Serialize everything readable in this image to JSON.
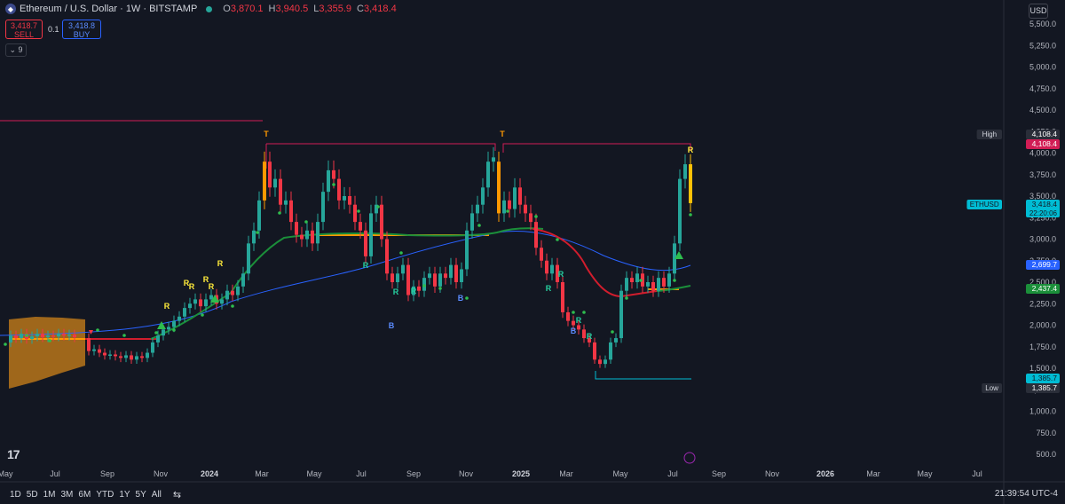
{
  "header": {
    "coin_icon": "ethereum-icon",
    "title": "Ethereum / U.S. Dollar · 1W · BITSTAMP",
    "status_color": "#26a69a",
    "ohlc": {
      "o_label": "O",
      "o": "3,870.1",
      "h_label": "H",
      "h": "3,940.5",
      "l_label": "L",
      "l": "3,355.9",
      "c_label": "C",
      "c": "3,418.4"
    }
  },
  "trade": {
    "sell_price": "3,418.7",
    "sell_label": "SELL",
    "spread": "0.1",
    "buy_price": "3,418.8",
    "buy_label": "BUY"
  },
  "indicators_toggle": "9",
  "currency": "USD",
  "price_axis": {
    "labels": [
      "5,500.0",
      "5,250.0",
      "5,000.0",
      "4,750.0",
      "4,500.0",
      "4,250.0",
      "4,000.0",
      "3,750.0",
      "3,500.0",
      "3,250.0",
      "3,000.0",
      "2,750.0",
      "2,500.0",
      "2,250.0",
      "2,000.0",
      "1,750.0",
      "1,500.0",
      "1,250.0",
      "1,000.0",
      "750.0",
      "500.0"
    ],
    "values": [
      5500,
      5250,
      5000,
      4750,
      4500,
      4250,
      4000,
      3750,
      3500,
      3250,
      3000,
      2750,
      2500,
      2250,
      2000,
      1750,
      1500,
      1250,
      1000,
      750,
      500
    ]
  },
  "price_badges": [
    {
      "label": "High",
      "value": "4,108.4",
      "color": "#2a2e39"
    },
    {
      "label": "",
      "value": "4,108.4",
      "color": "#d11d55"
    },
    {
      "label": "ETHUSD",
      "value": "3,418.4",
      "sub": "22:20:06",
      "color": "#00bcd4"
    },
    {
      "label": "",
      "value": "2,699.7",
      "color": "#2962ff"
    },
    {
      "label": "",
      "value": "2,437.4",
      "color": "#1b8f3a"
    },
    {
      "label": "",
      "value": "1,385.7",
      "color": "#00bcd4"
    },
    {
      "label": "Low",
      "value": "1,385.7",
      "color": "#2a2e39"
    }
  ],
  "time_axis": [
    "May",
    "Jul",
    "Sep",
    "Nov",
    "2024",
    "Mar",
    "May",
    "Jul",
    "Sep",
    "Nov",
    "2025",
    "Mar",
    "May",
    "Jul",
    "Sep",
    "Nov",
    "2026",
    "Mar",
    "May",
    "Jul"
  ],
  "chart_markers": {
    "top": "T",
    "reversal": "R",
    "bottom": "B"
  },
  "bottom_bar": {
    "timeframes": [
      "1D",
      "5D",
      "1M",
      "3M",
      "6M",
      "YTD",
      "1Y",
      "5Y",
      "All"
    ],
    "calendar_icon": "calendar-range-icon",
    "clock": "21:39:54 UTC-4"
  },
  "logo": "TradingView",
  "chart_data": {
    "type": "candlestick",
    "symbol": "ETHUSD",
    "interval": "1W",
    "ylim": [
      500,
      5500
    ],
    "x": [
      "2023-05",
      "2023-07",
      "2023-09",
      "2023-11",
      "2024-01",
      "2024-03",
      "2024-05",
      "2024-07",
      "2024-09",
      "2024-11",
      "2025-01",
      "2025-03",
      "2025-05",
      "2025-07"
    ],
    "close_approx": [
      1850,
      1880,
      1620,
      1950,
      2300,
      3600,
      3000,
      3200,
      2500,
      3300,
      3350,
      2100,
      1600,
      3418.4
    ],
    "last": {
      "open": 3870.1,
      "high": 3940.5,
      "low": 3355.9,
      "close": 3418.4
    },
    "period_high": 4108.4,
    "period_low": 1385.7,
    "ma_blue_last": 2699.7,
    "ma_green_last": 2437.4
  },
  "colors": {
    "up": "#26a69a",
    "down": "#f23645",
    "ma_blue": "#2962ff",
    "ma_green": "#1b8f3a",
    "ma_red": "#d11d2d",
    "level": "#d11d55",
    "orange": "#ff9800",
    "yellow": "#ffeb3b",
    "cyan": "#00bcd4"
  }
}
